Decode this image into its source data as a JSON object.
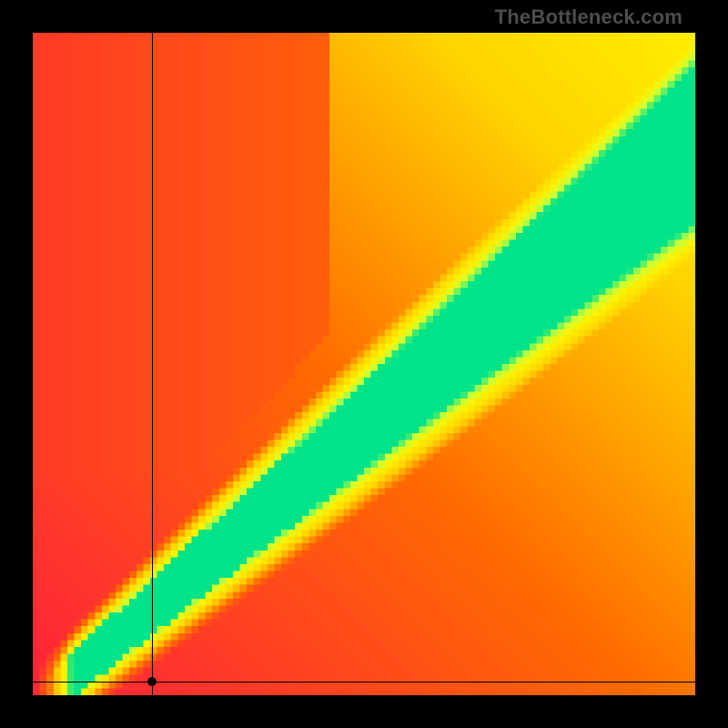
{
  "attribution": "TheBottleneck.com",
  "chart_data": {
    "type": "heatmap",
    "title": "",
    "xlabel": "",
    "ylabel": "",
    "xlim": [
      0,
      100
    ],
    "ylim": [
      0,
      100
    ],
    "legend": "none",
    "grid": false,
    "description": "Diagonal optimal band (green) on red-yellow gradient; pixelated density map.",
    "color_stops": [
      {
        "t": 0.0,
        "hex": "#ff1744"
      },
      {
        "t": 0.35,
        "hex": "#ff6a00"
      },
      {
        "t": 0.6,
        "hex": "#ffd400"
      },
      {
        "t": 0.78,
        "hex": "#fff200"
      },
      {
        "t": 0.9,
        "hex": "#c6ff3a"
      },
      {
        "t": 1.0,
        "hex": "#00e388"
      }
    ],
    "optimal_band": {
      "slope": 0.85,
      "intercept": -2,
      "half_width_start": 3,
      "half_width_end": 10
    },
    "marker": {
      "x": 18,
      "y": 2
    },
    "axis_lines": {
      "vertical_x": 18,
      "horizontal_y": 2
    },
    "grid_resolution": 96
  }
}
